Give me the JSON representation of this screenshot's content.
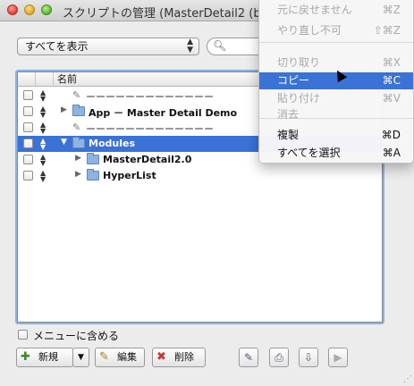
{
  "window": {
    "title": "スクリプトの管理 (MasterDetail2 (bi"
  },
  "toolbar_top": {
    "filter_select": {
      "value": "すべてを表示"
    },
    "search": {
      "placeholder": ""
    }
  },
  "list": {
    "header": {
      "col_name": "名前"
    },
    "rows": [
      {
        "type": "separator",
        "label": "ーーーーーーーーーーーーー",
        "indent": 0,
        "selected": false
      },
      {
        "type": "folder",
        "label": "App －  Master Detail Demo",
        "indent": 0,
        "expanded": false,
        "selected": false
      },
      {
        "type": "separator",
        "label": "ーーーーーーーーーーーーー",
        "indent": 0,
        "selected": false
      },
      {
        "type": "folder",
        "label": "Modules",
        "indent": 0,
        "expanded": true,
        "selected": true
      },
      {
        "type": "folder",
        "label": "MasterDetail2.0",
        "indent": 1,
        "expanded": false,
        "selected": false
      },
      {
        "type": "folder",
        "label": "HyperList",
        "indent": 1,
        "expanded": false,
        "selected": false
      }
    ]
  },
  "bottom": {
    "include_in_menu_label": "メニューに含める",
    "new_label": "新規",
    "edit_label": "編集",
    "delete_label": "削除"
  },
  "context_menu": {
    "items": [
      {
        "label": "元に戻せません",
        "shortcut": "⌘Z",
        "disabled": true
      },
      {
        "label": "やり直し不可",
        "shortcut": "⇧⌘Z",
        "disabled": true
      },
      {
        "label": "切り取り",
        "shortcut": "⌘X",
        "disabled": true
      },
      {
        "label": "コピー",
        "shortcut": "⌘C",
        "disabled": false,
        "highlighted": true
      },
      {
        "label": "貼り付け",
        "shortcut": "⌘V",
        "disabled": true
      },
      {
        "label": "消去",
        "shortcut": "",
        "disabled": true
      },
      {
        "label": "複製",
        "shortcut": "⌘D",
        "disabled": false
      },
      {
        "label": "すべてを選択",
        "shortcut": "⌘A",
        "disabled": false
      }
    ]
  },
  "colors": {
    "selection": "#3a72d6",
    "focus_ring": "#8ab2e6"
  },
  "icons": {
    "script": "script-icon",
    "folder": "folder-icon",
    "search": "search-icon"
  }
}
